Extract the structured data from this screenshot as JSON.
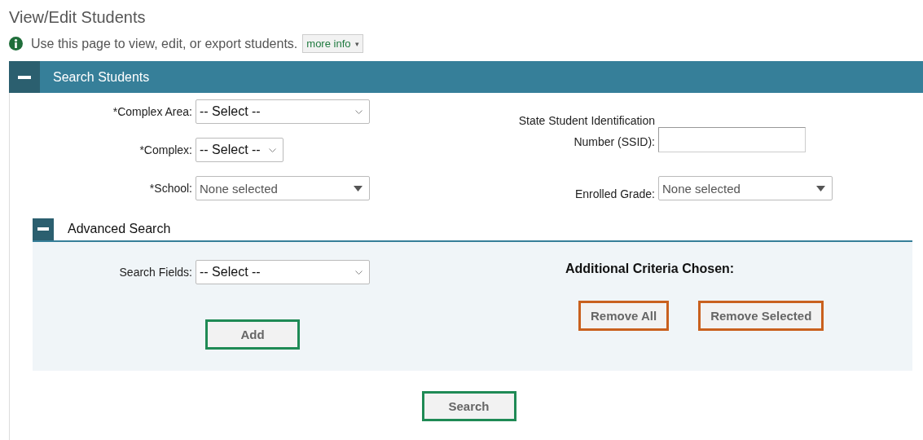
{
  "page": {
    "title": "View/Edit Students",
    "intro": "Use this page to view, edit, or export students.",
    "more_info": "more info",
    "more_info_caret": "▾"
  },
  "search_panel": {
    "title": "Search Students",
    "expanded": true,
    "left_fields": [
      {
        "label": "*Complex Area:",
        "kind": "select",
        "value": "-- Select --"
      },
      {
        "label": "*Complex:",
        "kind": "select",
        "value": "-- Select --"
      },
      {
        "label": "*School:",
        "kind": "multiselect",
        "value": "None selected"
      }
    ],
    "right_fields": [
      {
        "label": "State Student Identification Number (SSID):",
        "kind": "text"
      },
      {
        "label": "Enrolled Grade:",
        "kind": "multiselect",
        "value": "None selected"
      }
    ],
    "advanced": {
      "title": "Advanced Search",
      "expanded": true,
      "field": {
        "label": "Search Fields:",
        "kind": "select",
        "value": "-- Select --"
      },
      "add_button": {
        "label": "Add",
        "kind": "confirm"
      },
      "criteria_title": "Additional Criteria Chosen:",
      "criteria_buttons": [
        {
          "label": "Remove All",
          "kind": "remove"
        },
        {
          "label": "Remove Selected",
          "kind": "remove"
        }
      ]
    },
    "search_button": {
      "label": "Search",
      "kind": "confirm"
    }
  }
}
